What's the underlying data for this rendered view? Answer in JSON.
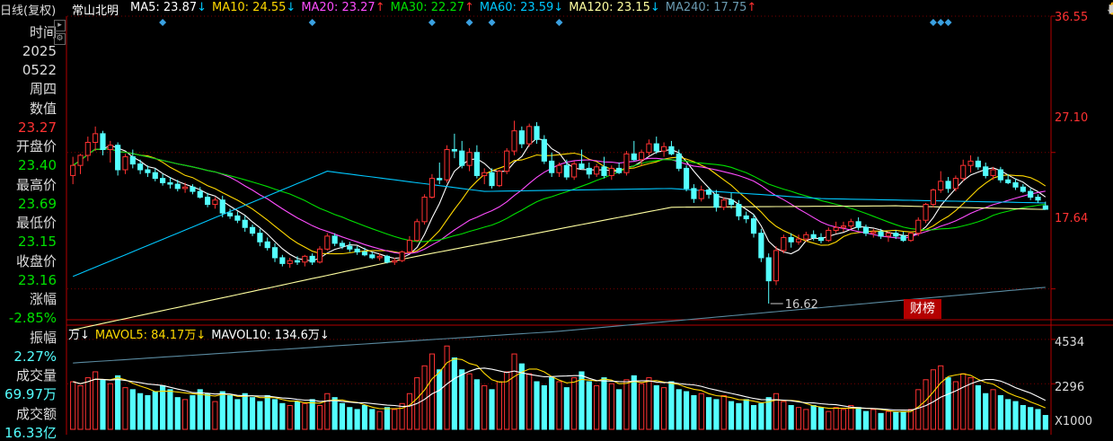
{
  "header": {
    "period_label": "日线(复权)",
    "stock_name": "常山北明",
    "ma_list": [
      {
        "label": "MA5: 23.87",
        "arrow": "↓",
        "color": "#ffffff"
      },
      {
        "label": "MA10: 24.55",
        "arrow": "↓",
        "color": "#ffd800"
      },
      {
        "label": "MA20: 23.27",
        "arrow": "↑",
        "color": "#ff4dff"
      },
      {
        "label": "MA30: 22.27",
        "arrow": "↑",
        "color": "#00e000"
      },
      {
        "label": "MA60: 23.59",
        "arrow": "↓",
        "color": "#00c8ff"
      },
      {
        "label": "MA120: 23.15",
        "arrow": "↓",
        "color": "#ffffa0"
      },
      {
        "label": "MA240: 17.75",
        "arrow": "↑",
        "color": "#6a9ab0"
      }
    ],
    "arrow_up_color": "#ff3030",
    "arrow_down_color": "#00c8ff",
    "toolbar_icons": [
      "eye-icon",
      "hand-icon",
      "play-icon",
      "undo-icon",
      "restore-icon",
      "lock-icon",
      "zoom-in-icon",
      "zoom-out-icon"
    ]
  },
  "info_panel": {
    "time_label": "时间",
    "year": "2025",
    "date": "0522",
    "weekday": "周四",
    "value_label": "数值",
    "value": "23.27",
    "open_label": "开盘价",
    "open": "23.40",
    "high_label": "最高价",
    "high": "23.69",
    "low_label": "最低价",
    "low": "23.15",
    "close_label": "收盘价",
    "close": "23.16",
    "change_label": "涨幅",
    "change": "-2.85%",
    "amplitude_label": "振幅",
    "amplitude": "2.27%",
    "volume_label": "成交量",
    "volume": "69.97万",
    "turnover_label": "成交额",
    "turnover": "16.33亿"
  },
  "price_axis": {
    "top": "36.55",
    "mid": "27.10",
    "low": "17.64"
  },
  "volume_axis": {
    "top": "4534",
    "mid": "2296",
    "unit": "X1000"
  },
  "min_price_marker": "16.62",
  "volume_header": [
    {
      "label": "万↓",
      "color": "#ffffff"
    },
    {
      "label": "MAVOL5: 84.17万↓",
      "color": "#ffd800"
    },
    {
      "label": "MAVOL10: 134.6万↓",
      "color": "#ffffff"
    }
  ],
  "caibang_button": "财榜",
  "colors": {
    "up": "#ff3232",
    "down": "#54ffff",
    "axis": "#b40000",
    "grid": "#7a0000"
  },
  "chart_data": {
    "type": "candlestick",
    "ylim": [
      15.5,
      36.55
    ],
    "volume_ylim": [
      0,
      4800
    ],
    "candles": [
      [
        25.5,
        26.8,
        24.9,
        26.2
      ],
      [
        26.2,
        27.0,
        25.6,
        26.9
      ],
      [
        26.9,
        28.2,
        26.5,
        27.8
      ],
      [
        27.8,
        28.9,
        27.2,
        28.4
      ],
      [
        28.4,
        28.6,
        26.9,
        27.3
      ],
      [
        27.3,
        27.9,
        26.4,
        27.6
      ],
      [
        27.6,
        27.8,
        25.5,
        25.9
      ],
      [
        25.9,
        27.0,
        25.6,
        26.8
      ],
      [
        26.8,
        27.3,
        26.0,
        26.3
      ],
      [
        26.3,
        26.6,
        25.6,
        25.9
      ],
      [
        25.9,
        26.2,
        25.4,
        25.7
      ],
      [
        25.7,
        26.0,
        25.1,
        25.3
      ],
      [
        25.3,
        25.6,
        24.8,
        25.0
      ],
      [
        25.0,
        25.4,
        24.6,
        24.9
      ],
      [
        24.9,
        25.2,
        24.4,
        24.6
      ],
      [
        24.6,
        25.0,
        24.3,
        24.7
      ],
      [
        24.7,
        24.9,
        24.2,
        24.4
      ],
      [
        24.4,
        24.7,
        23.9,
        24.0
      ],
      [
        24.0,
        24.3,
        23.3,
        23.5
      ],
      [
        23.5,
        24.0,
        23.2,
        23.8
      ],
      [
        23.8,
        24.1,
        22.6,
        22.9
      ],
      [
        22.9,
        23.2,
        22.5,
        22.7
      ],
      [
        22.7,
        23.0,
        22.2,
        22.4
      ],
      [
        22.4,
        22.7,
        21.6,
        21.9
      ],
      [
        21.9,
        22.1,
        21.3,
        21.5
      ],
      [
        21.5,
        21.8,
        20.6,
        20.9
      ],
      [
        20.9,
        21.2,
        20.3,
        20.5
      ],
      [
        20.5,
        20.8,
        19.5,
        19.8
      ],
      [
        19.8,
        20.0,
        19.2,
        19.4
      ],
      [
        19.4,
        19.8,
        19.1,
        19.6
      ],
      [
        19.6,
        19.9,
        19.3,
        19.5
      ],
      [
        19.5,
        20.0,
        19.2,
        19.9
      ],
      [
        19.9,
        20.1,
        19.3,
        19.5
      ],
      [
        19.5,
        20.6,
        19.4,
        20.4
      ],
      [
        20.4,
        21.5,
        20.3,
        21.3
      ],
      [
        21.3,
        21.5,
        20.6,
        20.8
      ],
      [
        20.8,
        21.0,
        20.4,
        20.6
      ],
      [
        20.6,
        20.9,
        20.2,
        20.4
      ],
      [
        20.4,
        20.6,
        20.0,
        20.2
      ],
      [
        20.2,
        20.5,
        19.9,
        20.0
      ],
      [
        20.0,
        20.2,
        19.7,
        19.8
      ],
      [
        19.8,
        20.1,
        19.6,
        19.9
      ],
      [
        19.9,
        20.0,
        19.4,
        19.5
      ],
      [
        19.5,
        19.8,
        19.3,
        19.6
      ],
      [
        19.6,
        20.3,
        19.5,
        20.2
      ],
      [
        20.2,
        21.3,
        20.1,
        21.0
      ],
      [
        21.0,
        22.5,
        20.9,
        22.3
      ],
      [
        22.3,
        24.2,
        22.1,
        24.0
      ],
      [
        24.0,
        25.6,
        23.9,
        25.3
      ],
      [
        25.3,
        26.4,
        24.9,
        25.2
      ],
      [
        25.2,
        27.6,
        25.0,
        27.3
      ],
      [
        27.3,
        28.4,
        26.7,
        27.2
      ],
      [
        27.2,
        27.9,
        26.0,
        26.2
      ],
      [
        26.2,
        27.4,
        25.8,
        27.1
      ],
      [
        27.1,
        27.6,
        25.3,
        25.5
      ],
      [
        25.5,
        26.0,
        24.9,
        25.7
      ],
      [
        25.7,
        26.0,
        24.6,
        24.8
      ],
      [
        24.8,
        25.9,
        24.7,
        25.8
      ],
      [
        25.8,
        27.4,
        25.6,
        27.2
      ],
      [
        27.2,
        29.3,
        26.9,
        28.6
      ],
      [
        28.6,
        28.9,
        27.4,
        27.7
      ],
      [
        27.7,
        29.1,
        27.5,
        28.9
      ],
      [
        28.9,
        29.2,
        27.7,
        28.0
      ],
      [
        28.0,
        28.3,
        26.3,
        26.5
      ],
      [
        26.5,
        27.1,
        25.4,
        25.7
      ],
      [
        25.7,
        26.4,
        25.4,
        26.2
      ],
      [
        26.2,
        26.6,
        25.2,
        25.4
      ],
      [
        25.4,
        26.5,
        25.2,
        26.3
      ],
      [
        26.3,
        27.3,
        25.9,
        26.0
      ],
      [
        26.0,
        26.4,
        25.3,
        25.6
      ],
      [
        25.6,
        26.3,
        25.4,
        26.1
      ],
      [
        26.1,
        26.8,
        25.3,
        25.5
      ],
      [
        25.5,
        26.2,
        25.2,
        26.0
      ],
      [
        26.0,
        26.4,
        25.6,
        25.7
      ],
      [
        25.7,
        27.2,
        25.5,
        27.0
      ],
      [
        27.0,
        27.9,
        26.5,
        26.6
      ],
      [
        26.6,
        27.3,
        26.2,
        27.1
      ],
      [
        27.1,
        28.0,
        26.9,
        27.7
      ],
      [
        27.7,
        28.2,
        27.0,
        27.2
      ],
      [
        27.2,
        27.8,
        26.8,
        27.5
      ],
      [
        27.5,
        27.9,
        26.9,
        27.0
      ],
      [
        27.0,
        27.3,
        25.8,
        26.0
      ],
      [
        26.0,
        26.2,
        24.4,
        24.6
      ],
      [
        24.6,
        24.9,
        23.6,
        23.9
      ],
      [
        23.9,
        24.8,
        23.7,
        24.5
      ],
      [
        24.5,
        24.7,
        23.9,
        24.2
      ],
      [
        24.2,
        24.5,
        23.0,
        23.3
      ],
      [
        23.3,
        24.0,
        23.1,
        23.8
      ],
      [
        23.8,
        24.3,
        23.2,
        23.5
      ],
      [
        23.5,
        23.8,
        22.4,
        22.7
      ],
      [
        22.7,
        23.0,
        22.2,
        22.5
      ],
      [
        22.5,
        22.8,
        21.2,
        21.5
      ],
      [
        21.5,
        21.8,
        19.5,
        19.8
      ],
      [
        19.8,
        20.1,
        16.62,
        18.2
      ],
      [
        18.2,
        20.6,
        17.9,
        20.3
      ],
      [
        20.3,
        21.4,
        20.1,
        21.2
      ],
      [
        21.2,
        21.5,
        20.5,
        20.9
      ],
      [
        20.9,
        21.4,
        20.7,
        21.1
      ],
      [
        21.1,
        21.6,
        20.9,
        21.4
      ],
      [
        21.4,
        21.7,
        21.0,
        21.2
      ],
      [
        21.2,
        21.5,
        20.8,
        21.0
      ],
      [
        21.0,
        21.9,
        20.9,
        21.7
      ],
      [
        21.7,
        22.3,
        21.5,
        21.9
      ],
      [
        21.9,
        22.3,
        21.6,
        22.0
      ],
      [
        22.0,
        22.5,
        21.8,
        22.3
      ],
      [
        22.3,
        22.6,
        21.7,
        21.9
      ],
      [
        21.9,
        22.1,
        21.3,
        21.5
      ],
      [
        21.5,
        21.8,
        21.2,
        21.6
      ],
      [
        21.6,
        21.8,
        21.1,
        21.3
      ],
      [
        21.3,
        21.6,
        20.9,
        21.5
      ],
      [
        21.5,
        21.7,
        21.1,
        21.3
      ],
      [
        21.3,
        21.6,
        20.9,
        21.0
      ],
      [
        21.0,
        21.6,
        20.9,
        21.5
      ],
      [
        21.5,
        22.6,
        21.3,
        22.4
      ],
      [
        22.4,
        23.6,
        22.2,
        23.5
      ],
      [
        23.5,
        24.6,
        23.3,
        24.5
      ],
      [
        24.5,
        25.8,
        24.3,
        25.1
      ],
      [
        25.1,
        25.4,
        24.3,
        24.6
      ],
      [
        24.6,
        25.5,
        24.4,
        25.3
      ],
      [
        25.3,
        26.6,
        25.1,
        26.2
      ],
      [
        26.2,
        26.9,
        25.7,
        26.5
      ],
      [
        26.5,
        26.8,
        25.9,
        26.1
      ],
      [
        26.1,
        26.4,
        25.3,
        25.5
      ],
      [
        25.5,
        26.1,
        25.2,
        25.9
      ],
      [
        25.9,
        26.1,
        25.0,
        25.2
      ],
      [
        25.2,
        25.6,
        24.9,
        25.0
      ],
      [
        25.0,
        25.3,
        24.5,
        24.7
      ],
      [
        24.7,
        24.9,
        24.3,
        24.4
      ],
      [
        24.4,
        24.6,
        23.8,
        24.0
      ],
      [
        24.0,
        24.2,
        23.6,
        23.8
      ],
      [
        23.4,
        23.69,
        23.15,
        23.16
      ]
    ],
    "volumes": [
      2400,
      2200,
      2600,
      2900,
      2500,
      2300,
      2700,
      2100,
      2000,
      1800,
      1700,
      1900,
      2200,
      2000,
      1600,
      1500,
      1700,
      2000,
      1800,
      1400,
      1900,
      1700,
      1500,
      1800,
      1600,
      1400,
      1700,
      1500,
      1300,
      1200,
      1400,
      1300,
      1500,
      1200,
      1800,
      1600,
      1300,
      1100,
      1000,
      1200,
      1000,
      900,
      1100,
      1000,
      1300,
      1800,
      2600,
      3200,
      3800,
      3000,
      4200,
      3600,
      3000,
      2800,
      2500,
      2200,
      2000,
      2400,
      2900,
      3800,
      3300,
      2800,
      2400,
      2200,
      2600,
      2400,
      2100,
      2600,
      2900,
      2400,
      2200,
      2600,
      2300,
      2000,
      2500,
      2700,
      2300,
      2600,
      2200,
      2100,
      2400,
      2000,
      1900,
      1700,
      1800,
      1600,
      1500,
      1700,
      1400,
      1300,
      1500,
      1200,
      1300,
      1600,
      1800,
      1400,
      1200,
      1100,
      1000,
      1200,
      1100,
      900,
      1100,
      1000,
      1200,
      1100,
      900,
      1000,
      800,
      900,
      850,
      900,
      1000,
      2000,
      2500,
      3000,
      3200,
      2600,
      2400,
      2800,
      2600,
      2200,
      1800,
      2000,
      1700,
      1500,
      1400,
      1200,
      1100,
      1000,
      700
    ],
    "ma_overlays": [
      {
        "name": "MA5",
        "color": "#ffffff",
        "period": 5
      },
      {
        "name": "MA10",
        "color": "#ffd800",
        "period": 10
      },
      {
        "name": "MA20",
        "color": "#ff4dff",
        "period": 20
      },
      {
        "name": "MA30",
        "color": "#00e000",
        "period": 30
      },
      {
        "name": "MA60",
        "color": "#00c8ff",
        "anchors": [
          [
            0,
            18.5
          ],
          [
            34,
            25.8
          ],
          [
            55,
            24.4
          ],
          [
            80,
            24.6
          ],
          [
            100,
            23.9
          ],
          [
            130,
            23.6
          ]
        ]
      },
      {
        "name": "MA120",
        "color": "#ffffa0",
        "anchors": [
          [
            0,
            14.8
          ],
          [
            45,
            19.8
          ],
          [
            80,
            23.3
          ],
          [
            110,
            23.4
          ],
          [
            130,
            23.15
          ]
        ]
      },
      {
        "name": "MA240",
        "color": "#5a8aa0",
        "anchors": [
          [
            0,
            12.5
          ],
          [
            65,
            14.7
          ],
          [
            130,
            17.75
          ]
        ]
      }
    ],
    "volume_ma": [
      {
        "name": "MAVOL5",
        "color": "#ffd800",
        "period": 5
      },
      {
        "name": "MAVOL10",
        "color": "#ffffff",
        "period": 10
      }
    ],
    "event_markers_x": [
      12,
      32,
      48,
      53,
      56,
      65,
      115,
      116,
      117
    ]
  }
}
